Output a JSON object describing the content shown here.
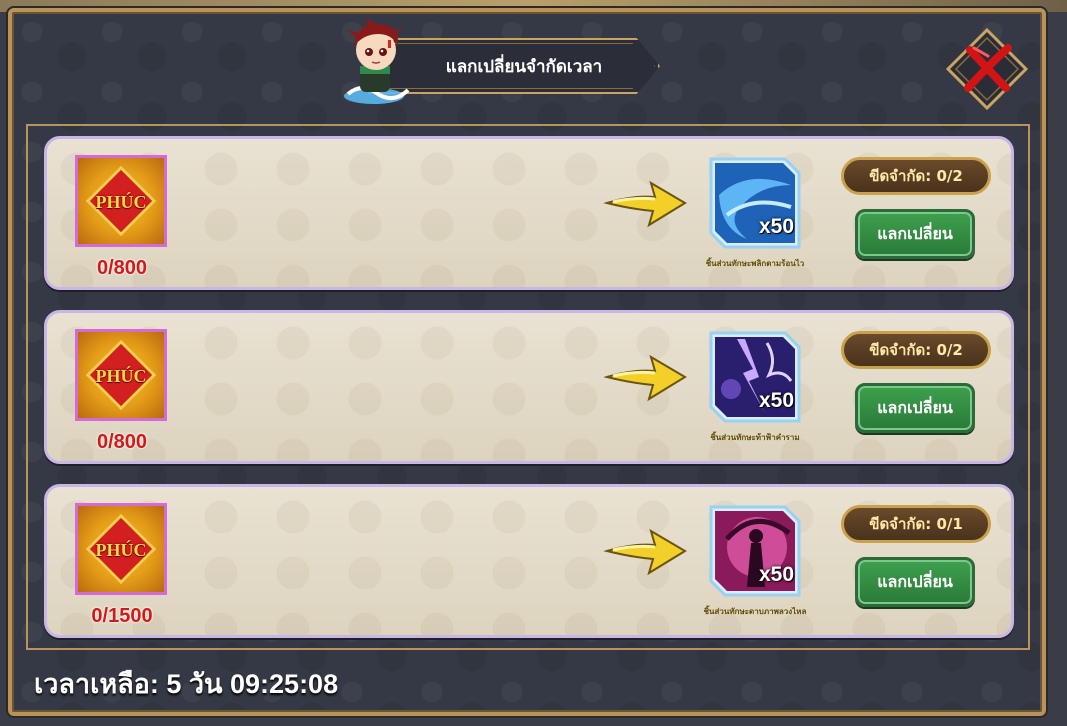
{
  "title": "แลกเปลี่ยนจำกัดเวลา",
  "timer": {
    "label": "เวลาเหลือ: 5 วัน 09:25:08"
  },
  "rows": [
    {
      "token_label": "PHÚC",
      "token_count": "0/800",
      "reward_quantity": "x50",
      "reward_name": "ชิ้นส่วนทักษะพลิกตามร้อนไว",
      "reward_color": "#2e7fd6",
      "limit": "ขีดจำกัด: 0/2",
      "button": "แลกเปลี่ยน"
    },
    {
      "token_label": "PHÚC",
      "token_count": "0/800",
      "reward_quantity": "x50",
      "reward_name": "ชิ้นส่วนทักษะท้าฟ้าคำราม",
      "reward_color": "#6b3fd0",
      "limit": "ขีดจำกัด: 0/2",
      "button": "แลกเปลี่ยน"
    },
    {
      "token_label": "PHÚC",
      "token_count": "0/1500",
      "reward_quantity": "x50",
      "reward_name": "ชิ้นส่วนทักษะดาบภาพลวงไหล",
      "reward_color": "#c3348f",
      "limit": "ขีดจำกัด: 0/1",
      "button": "แลกเปลี่ยน"
    }
  ],
  "icons": {
    "close": "close-x-icon",
    "arrow": "arrow-right-icon",
    "token": "phuc-token-icon",
    "mascot": "chibi-character-icon"
  }
}
